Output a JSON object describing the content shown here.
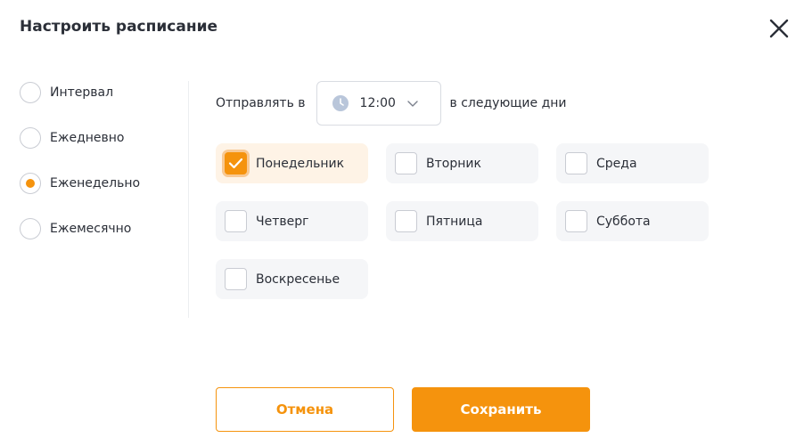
{
  "dialog": {
    "title": "Настроить расписание"
  },
  "frequency": {
    "selected": "Еженедельно",
    "options": [
      {
        "label": "Интервал",
        "checked": false
      },
      {
        "label": "Ежедневно",
        "checked": false
      },
      {
        "label": "Еженедельно",
        "checked": true
      },
      {
        "label": "Ежемесячно",
        "checked": false
      }
    ]
  },
  "schedule": {
    "send_label": "Отправлять в",
    "time": "12:00",
    "after_label": "в следующие дни"
  },
  "days": [
    {
      "label": "Понедельник",
      "checked": true
    },
    {
      "label": "Вторник",
      "checked": false
    },
    {
      "label": "Среда",
      "checked": false
    },
    {
      "label": "Четверг",
      "checked": false
    },
    {
      "label": "Пятница",
      "checked": false
    },
    {
      "label": "Суббота",
      "checked": false
    },
    {
      "label": "Воскресенье",
      "checked": false
    }
  ],
  "actions": {
    "cancel_label": "Отмена",
    "save_label": "Сохранить"
  },
  "colors": {
    "accent": "#f5930d",
    "accent_light": "#fef3e6",
    "day_bg": "#f5f6f8",
    "text": "#2b2f38"
  },
  "icons": {
    "close": "close-icon",
    "clock": "clock-icon",
    "chevron": "chevron-down-icon",
    "check": "checkmark-icon"
  }
}
